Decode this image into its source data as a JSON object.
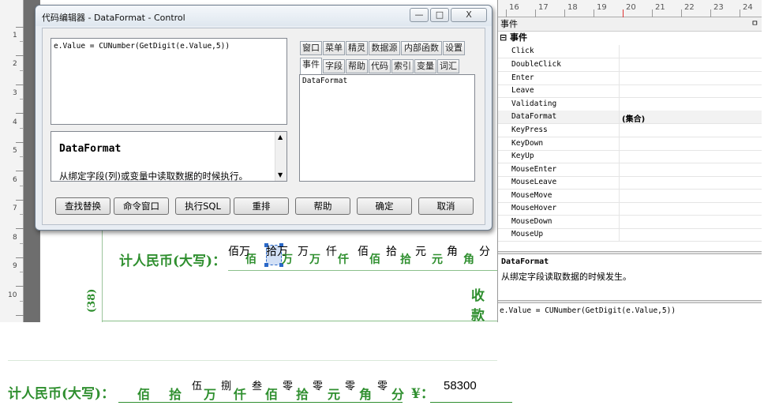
{
  "left_ruler": {
    "numbers": [
      "1",
      "2",
      "3",
      "4",
      "5",
      "6",
      "7",
      "8",
      "9",
      "10"
    ]
  },
  "designer": {
    "amount_label": "计人民币(大写)：",
    "field_values": [
      "佰万",
      "拾万",
      "万",
      "仟",
      "佰",
      "拾",
      "元",
      "角",
      "分"
    ],
    "field_units": [
      "佰",
      "万",
      "万",
      "仟",
      "佰",
      "拾",
      "元",
      "角"
    ],
    "side_label": "(38)",
    "receipt_label": "收款"
  },
  "dialog": {
    "title": "代码编辑器 - DataFormat - Control",
    "window_buttons": {
      "minimize": "—",
      "maximize": "□",
      "close": "X"
    },
    "code": "e.Value = CUNumber(GetDigit(e.Value,5))",
    "help_title": "DataFormat",
    "help_desc": "从绑定字段(列)或变量中读取数据的时候执行。",
    "tabs_row1": [
      "窗口",
      "菜单",
      "精灵",
      "数据源",
      "内部函数",
      "设置"
    ],
    "tabs_row2": [
      "事件",
      "字段",
      "帮助",
      "代码",
      "索引",
      "变量",
      "词汇"
    ],
    "list_items": [
      "DataFormat"
    ],
    "buttons": {
      "find_replace": "查找替换",
      "command_window": "命令窗口",
      "exec_sql": "执行SQL",
      "rearrange": "重排",
      "help": "帮助",
      "ok": "确定",
      "cancel": "取消"
    }
  },
  "props": {
    "ruler_numbers": [
      "16",
      "17",
      "18",
      "19",
      "20",
      "21",
      "22",
      "23",
      "24"
    ],
    "header": "事件",
    "pin": "ㅁ",
    "category": "⊟ 事件",
    "rows": [
      {
        "name": "Click",
        "value": ""
      },
      {
        "name": "DoubleClick",
        "value": ""
      },
      {
        "name": "Enter",
        "value": ""
      },
      {
        "name": "Leave",
        "value": ""
      },
      {
        "name": "Validating",
        "value": ""
      },
      {
        "name": "DataFormat",
        "value": "(集合)"
      },
      {
        "name": "KeyPress",
        "value": ""
      },
      {
        "name": "KeyDown",
        "value": ""
      },
      {
        "name": "KeyUp",
        "value": ""
      },
      {
        "name": "MouseEnter",
        "value": ""
      },
      {
        "name": "MouseLeave",
        "value": ""
      },
      {
        "name": "MouseMove",
        "value": ""
      },
      {
        "name": "MouseHover",
        "value": ""
      },
      {
        "name": "MouseDown",
        "value": ""
      },
      {
        "name": "MouseUp",
        "value": ""
      }
    ],
    "desc_title": "DataFormat",
    "desc_text": "从绑定字段读取数据的时候发生。",
    "expression": "e.Value = CUNumber(GetDigit(e.Value,5))"
  },
  "preview": {
    "amount_label": "计人民币(大写)：",
    "cells": [
      {
        "unit": "佰",
        "value": ""
      },
      {
        "unit": "拾",
        "value": "伍"
      },
      {
        "unit": "万",
        "value": "捌"
      },
      {
        "unit": "仟",
        "value": "叁"
      },
      {
        "unit": "佰",
        "value": "零"
      },
      {
        "unit": "拾",
        "value": "零"
      },
      {
        "unit": "元",
        "value": "零"
      },
      {
        "unit": "角",
        "value": "零"
      },
      {
        "unit": "分",
        "value": ""
      }
    ],
    "yen_label": "¥：",
    "amount_value": "58300",
    "colors": {
      "green": "#2f8f2f"
    }
  }
}
